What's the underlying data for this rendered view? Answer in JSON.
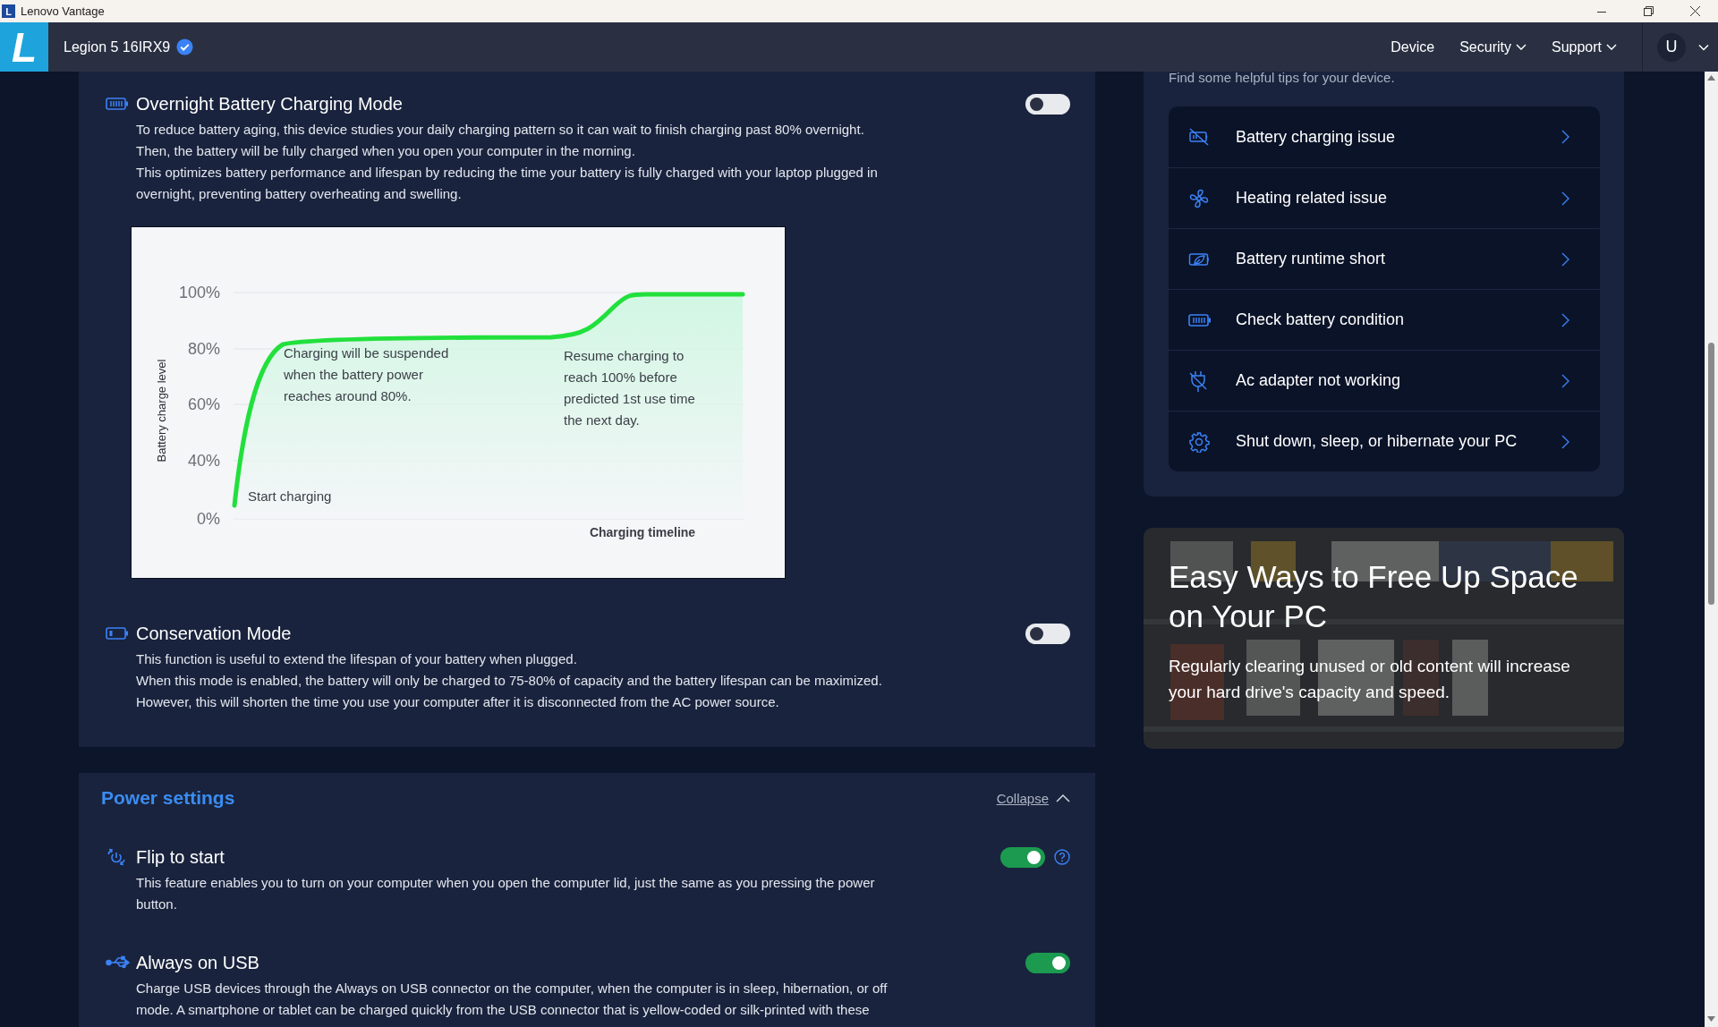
{
  "window": {
    "icon_letter": "L",
    "title": "Lenovo Vantage"
  },
  "nav": {
    "logo_letter": "L",
    "device_name": "Legion 5 16IRX9",
    "verified": true,
    "links": [
      {
        "label": "Device",
        "has_menu": false
      },
      {
        "label": "Security",
        "has_menu": true
      },
      {
        "label": "Support",
        "has_menu": true
      }
    ],
    "avatar_letter": "U"
  },
  "battery_section": {
    "settings": [
      {
        "title": "Overnight Battery Charging Mode",
        "description": [
          "To reduce battery aging, this device studies your daily charging pattern so it can wait to finish charging past 80% overnight.",
          "Then, the battery will be fully charged when you open your computer in the morning.",
          "This optimizes battery performance and lifespan by reducing the time your battery is fully charged with your laptop plugged in overnight, preventing battery overheating and swelling."
        ],
        "on": false,
        "illustration": {
          "ylabel": "Battery charge level",
          "xlabel": "Charging timeline",
          "yticks": [
            "100%",
            "80%",
            "60%",
            "40%",
            "0%"
          ],
          "annotations": [
            "Start charging",
            "Charging will be suspended when the battery power reaches around 80%.",
            "Resume charging to reach 100% before predicted 1st use time the next day."
          ]
        }
      },
      {
        "title": "Conservation Mode",
        "description": [
          "This function is useful to extend the lifespan of your battery when plugged.",
          "When this mode is enabled, the battery will only be charged to 75-80% of capacity and the battery lifespan can be maximized.",
          "However, this will shorten the time you use your computer after it is disconnected from the AC power source."
        ],
        "on": false
      }
    ]
  },
  "power_settings": {
    "title": "Power settings",
    "collapse_label": "Collapse",
    "expanded": true,
    "settings": [
      {
        "title": "Flip to start",
        "description": [
          "This feature enables you to turn on your computer when you open the computer lid, just the same as you pressing the power button."
        ],
        "on": true,
        "help": true
      },
      {
        "title": "Always on USB",
        "description": [
          "Charge USB devices through the Always on USB connector on the computer, when the computer is in sleep, hibernation, or off mode. A smartphone or tablet can be charged quickly from the USB connector that is yellow-coded or silk-printed with these"
        ],
        "on": true,
        "help": false
      }
    ]
  },
  "tips": {
    "subtitle": "Find some helpful tips for your device.",
    "items": [
      "Battery charging issue",
      "Heating related issue",
      "Battery runtime short",
      "Check battery condition",
      "Ac adapter not working",
      "Shut down, sleep, or hibernate your PC"
    ]
  },
  "promo": {
    "title": "Easy Ways to Free Up Space on Your PC",
    "text": "Regularly clearing unused or old content will increase your hard drive's capacity and speed."
  }
}
